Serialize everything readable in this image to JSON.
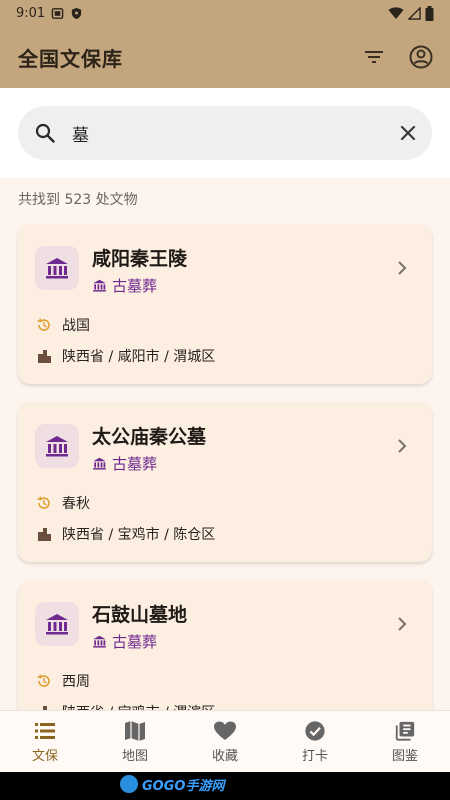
{
  "status_bar": {
    "time": "9:01"
  },
  "app_bar": {
    "title": "全国文保库"
  },
  "search": {
    "value": "墓"
  },
  "results": {
    "count_text": "共找到 523 处文物",
    "items": [
      {
        "name": "咸阳秦王陵",
        "type": "古墓葬",
        "era": "战国",
        "location": "陕西省 / 咸阳市 / 渭城区"
      },
      {
        "name": "太公庙秦公墓",
        "type": "古墓葬",
        "era": "春秋",
        "location": "陕西省 / 宝鸡市 / 陈仓区"
      },
      {
        "name": "石鼓山墓地",
        "type": "古墓葬",
        "era": "西周",
        "location": "陕西省 / 宝鸡市 / 渭滨区"
      }
    ]
  },
  "bottom_nav": [
    {
      "label": "文保",
      "icon": "list-icon",
      "active": true
    },
    {
      "label": "地图",
      "icon": "map-icon",
      "active": false
    },
    {
      "label": "收藏",
      "icon": "heart-icon",
      "active": false
    },
    {
      "label": "打卡",
      "icon": "check-circle-icon",
      "active": false
    },
    {
      "label": "图鉴",
      "icon": "collection-icon",
      "active": false
    }
  ],
  "watermark": {
    "text": "GOGO手游网"
  },
  "colors": {
    "app_bar": "#c4a67e",
    "accent_purple": "#6e2a8e",
    "nav_active": "#8a6522",
    "card_bg": "#fdeee2",
    "era_icon": "#e0a030"
  }
}
